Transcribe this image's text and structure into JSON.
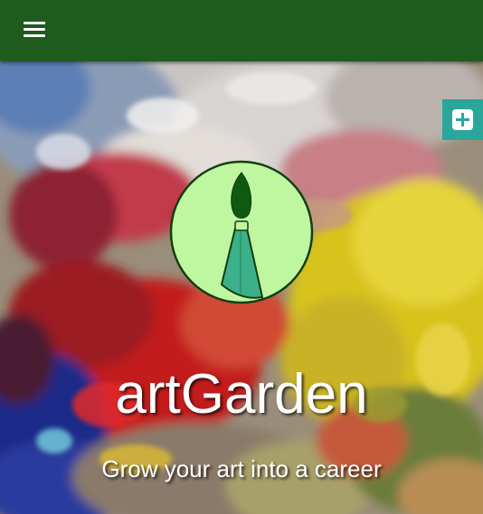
{
  "header": {
    "menu_icon": "hamburger-menu-icon",
    "color": "#1e5c1e"
  },
  "side_action": {
    "icon": "plus-square-icon",
    "color": "#2aa79a"
  },
  "hero": {
    "logo_icon": "paintbrush-logo-icon",
    "logo_fill": "#bff7a0",
    "title": "artGarden",
    "tagline": "Grow your art into a career"
  }
}
